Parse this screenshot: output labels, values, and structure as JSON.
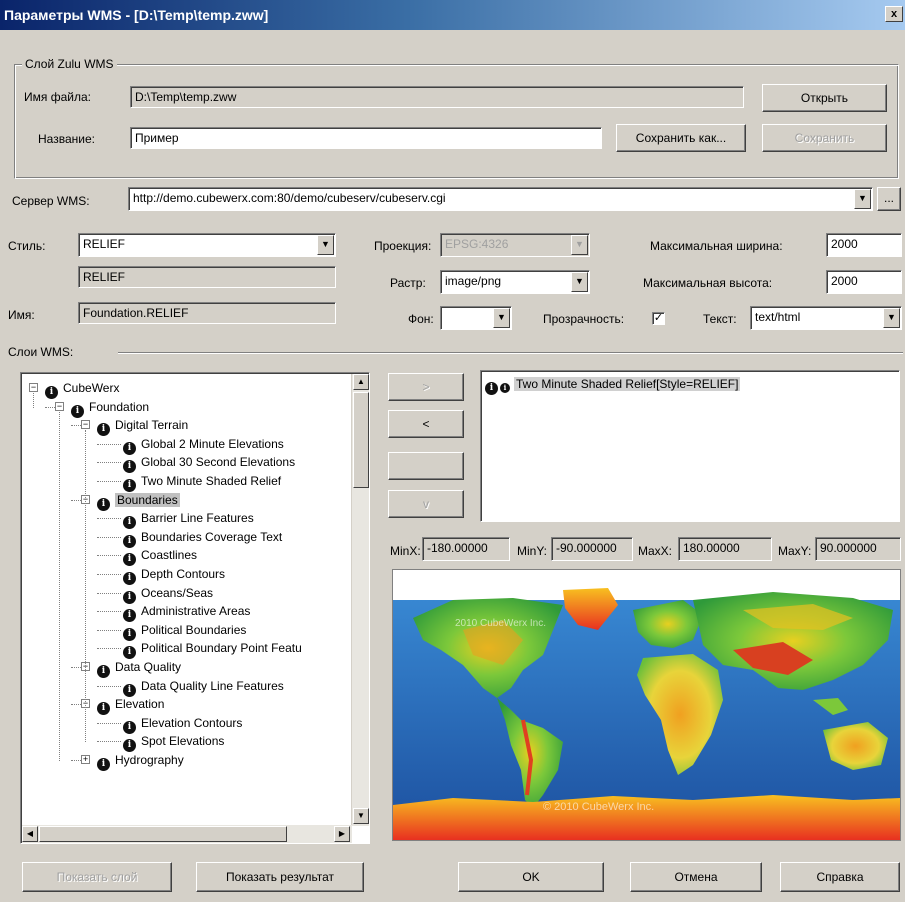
{
  "window": {
    "title": "Параметры WMS - [D:\\Temp\\temp.zww]",
    "close_glyph": "x"
  },
  "zulu_group": {
    "title": "Слой Zulu WMS",
    "file_label": "Имя файла:",
    "file_value": "D:\\Temp\\temp.zww",
    "name_label": "Название:",
    "name_value": "Пример",
    "open_button": "Открыть",
    "save_as_button": "Сохранить как...",
    "save_button": "Сохранить"
  },
  "server": {
    "label": "Сервер WMS:",
    "value": "http://demo.cubewerx.com:80/demo/cubeserv/cubeserv.cgi",
    "browse_button": "..."
  },
  "style": {
    "label": "Стиль:",
    "value": "RELIEF",
    "title_value": "RELIEF"
  },
  "name": {
    "label": "Имя:",
    "value": "Foundation.RELIEF"
  },
  "projection": {
    "label": "Проекция:",
    "value": "EPSG:4326"
  },
  "raster": {
    "label": "Растр:",
    "value": "image/png"
  },
  "background": {
    "label": "Фон:",
    "value": ""
  },
  "transparency": {
    "label": "Прозрачность:",
    "checked": true,
    "check_glyph": "✓"
  },
  "max_width": {
    "label": "Максимальная ширина:",
    "value": "2000"
  },
  "max_height": {
    "label": "Максимальная высота:",
    "value": "2000"
  },
  "text_format": {
    "label": "Текст:",
    "value": "text/html"
  },
  "layers_label": "Слои WMS:",
  "tree": {
    "nodes": [
      {
        "label": "CubeWerx",
        "level": 0,
        "expander": "−"
      },
      {
        "label": "Foundation",
        "level": 1,
        "expander": "−"
      },
      {
        "label": "Digital Terrain",
        "level": 2,
        "expander": "−"
      },
      {
        "label": "Global 2 Minute Elevations",
        "level": 3,
        "expander": ""
      },
      {
        "label": "Global 30 Second Elevations",
        "level": 3,
        "expander": ""
      },
      {
        "label": "Two Minute Shaded Relief",
        "level": 3,
        "expander": ""
      },
      {
        "label": "Boundaries",
        "level": 2,
        "expander": "−",
        "selected": true
      },
      {
        "label": "Barrier Line Features",
        "level": 3,
        "expander": ""
      },
      {
        "label": "Boundaries Coverage Text",
        "level": 3,
        "expander": ""
      },
      {
        "label": "Coastlines",
        "level": 3,
        "expander": ""
      },
      {
        "label": "Depth Contours",
        "level": 3,
        "expander": ""
      },
      {
        "label": "Oceans/Seas",
        "level": 3,
        "expander": ""
      },
      {
        "label": "Administrative Areas",
        "level": 3,
        "expander": ""
      },
      {
        "label": "Political Boundaries",
        "level": 3,
        "expander": ""
      },
      {
        "label": "Political Boundary Point Featu",
        "level": 3,
        "expander": ""
      },
      {
        "label": "Data Quality",
        "level": 2,
        "expander": "−"
      },
      {
        "label": "Data Quality Line Features",
        "level": 3,
        "expander": ""
      },
      {
        "label": "Elevation",
        "level": 2,
        "expander": "−"
      },
      {
        "label": "Elevation Contours",
        "level": 3,
        "expander": ""
      },
      {
        "label": "Spot Elevations",
        "level": 3,
        "expander": ""
      },
      {
        "label": "Hydrography",
        "level": 2,
        "expander": "+"
      }
    ]
  },
  "transfer_buttons": [
    ">",
    "<",
    "",
    "v"
  ],
  "selected_layers": [
    {
      "label": "Two Minute Shaded Relief[Style=RELIEF]"
    }
  ],
  "bbox": {
    "minx_label": "MinX:",
    "minx": "-180.00000",
    "miny_label": "MinY:",
    "miny": "-90.000000",
    "maxx_label": "MaxX:",
    "maxx": "180.00000",
    "maxy_label": "MaxY:",
    "maxy": "90.000000"
  },
  "map": {
    "watermark_top": "2010 CubeWerx Inc.",
    "watermark_bottom": "© 2010 CubeWerx Inc."
  },
  "buttons": {
    "show_layer": "Показать слой",
    "show_result": "Показать результат",
    "ok": "OK",
    "cancel": "Отмена",
    "help": "Справка"
  },
  "colors": {
    "title_start": "#0a246a",
    "face": "#d4d0c8",
    "ocean": "#1a5fb4"
  },
  "icons": {
    "info": "i",
    "scroll_up": "▲",
    "scroll_down": "▼",
    "scroll_left": "◀",
    "scroll_right": "▶",
    "combo_arrow": "▼"
  }
}
